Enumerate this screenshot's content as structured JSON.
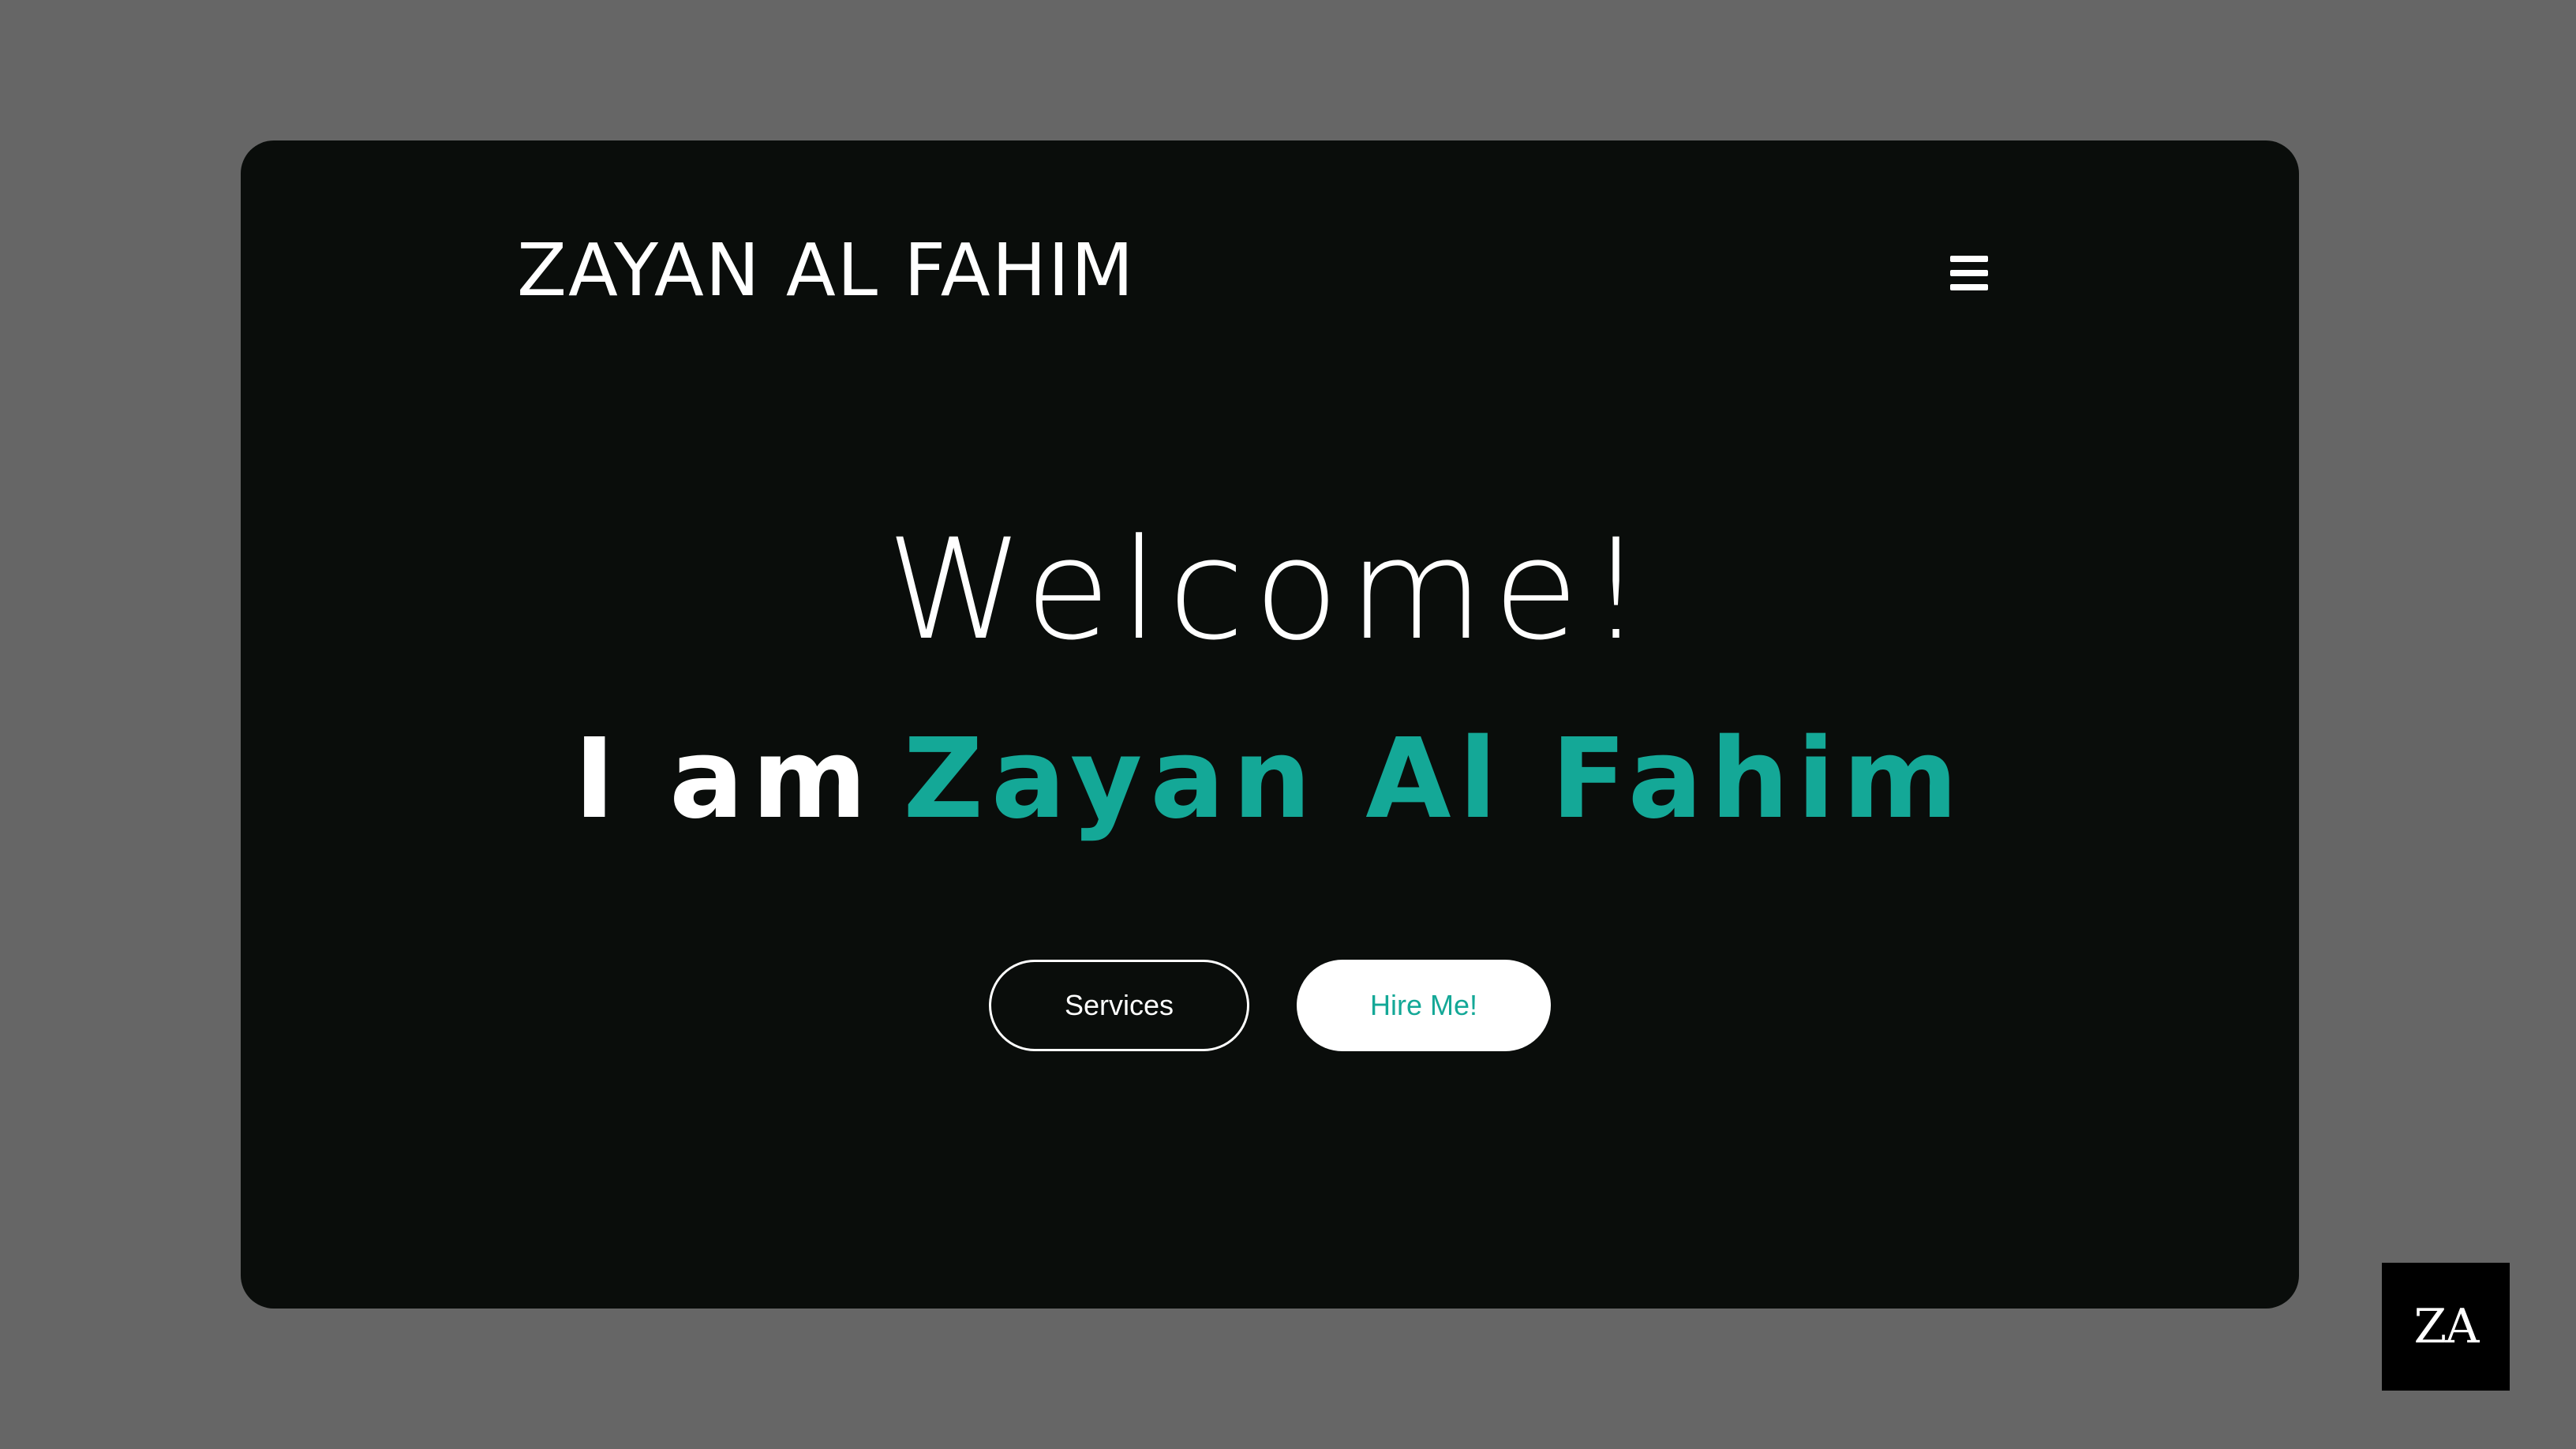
{
  "header": {
    "brand": "ZAYAN AL FAHIM",
    "menu_icon": "hamburger-menu-icon"
  },
  "hero": {
    "welcome": "Welcome!",
    "intro_prefix": "I am",
    "intro_name": "Zayan Al Fahim"
  },
  "actions": {
    "services_label": "Services",
    "hire_label": "Hire Me!"
  },
  "watermark": {
    "text": "ZA"
  },
  "colors": {
    "page_background": "#666666",
    "card_background": "#0a0d0b",
    "accent": "#14a897",
    "text": "#ffffff"
  }
}
